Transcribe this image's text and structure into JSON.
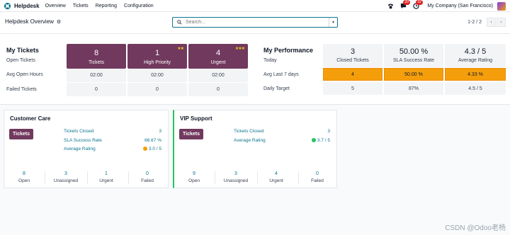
{
  "nav": {
    "app_name": "Helpdesk",
    "menus": [
      "Overview",
      "Tickets",
      "Reporting",
      "Configuration"
    ],
    "chat_badge": "20",
    "activity_badge": "32",
    "company": "My Company (San Francisco)"
  },
  "control": {
    "breadcrumb": "Helpdesk Overview",
    "search_placeholder": "Search...",
    "pager": "1-2 / 2"
  },
  "my_tickets": {
    "title": "My Tickets",
    "subtitle": "Open Tickets",
    "row_labels": [
      "Avg Open Hours",
      "Failed Tickets"
    ],
    "columns": [
      {
        "count": "8",
        "label": "Tickets",
        "stars": "",
        "avg_hours": "02:00",
        "failed": "0"
      },
      {
        "count": "1",
        "label": "High Priority",
        "stars": "★★",
        "avg_hours": "02:00",
        "failed": "0"
      },
      {
        "count": "4",
        "label": "Urgent",
        "stars": "★★★",
        "avg_hours": "02:00",
        "failed": "0"
      }
    ]
  },
  "my_performance": {
    "title": "My Performance",
    "subtitle": "Today",
    "row_labels": [
      "Avg Last 7 days",
      "Daily Target"
    ],
    "columns": [
      {
        "value": "3",
        "label": "Closed Tickets",
        "avg7": "4",
        "target": "5"
      },
      {
        "value": "50.00 %",
        "label": "SLA Success Rate",
        "avg7": "50.00 %",
        "target": "87%"
      },
      {
        "value": "4.3 / 5",
        "label": "Average Rating",
        "avg7": "4.33 %",
        "target": "4.5 / 5"
      }
    ]
  },
  "teams": [
    {
      "name": "Customer Care",
      "button": "Tickets",
      "stats": [
        {
          "label": "Tickets Closed",
          "value": "3"
        },
        {
          "label": "SLA Success Rate",
          "value": "66.67 %"
        },
        {
          "label": "Average Rating",
          "value": "3.0 / 5"
        }
      ],
      "bottom": [
        {
          "num": "8",
          "label": "Open"
        },
        {
          "num": "3",
          "label": "Unassigned"
        },
        {
          "num": "1",
          "label": "Urgent"
        },
        {
          "num": "0",
          "label": "Failed"
        }
      ]
    },
    {
      "name": "VIP Support",
      "button": "Tickets",
      "stats": [
        {
          "label": "Tickets Closed",
          "value": "3"
        },
        {
          "label": "Average Rating",
          "value": "3.7 / 5"
        }
      ],
      "bottom": [
        {
          "num": "9",
          "label": "Open"
        },
        {
          "num": "3",
          "label": "Unassigned"
        },
        {
          "num": "4",
          "label": "Urgent"
        },
        {
          "num": "0",
          "label": "Failed"
        }
      ]
    }
  ],
  "watermark": "CSDN @Odoo老杨",
  "colors": {
    "brand": "#71395e",
    "link": "#0e7490",
    "orange": "#f59e0b",
    "active": "#22c55e"
  }
}
